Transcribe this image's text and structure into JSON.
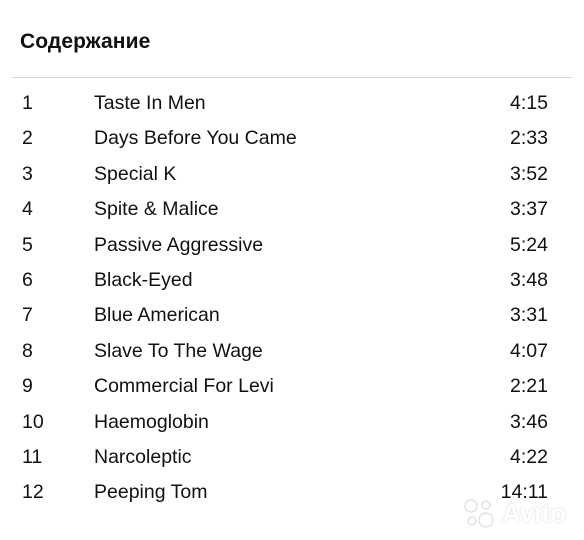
{
  "page": {
    "title": "Содержание"
  },
  "tracks": [
    {
      "number": "1",
      "title": "Taste In Men",
      "duration": "4:15"
    },
    {
      "number": "2",
      "title": "Days Before You Came",
      "duration": "2:33"
    },
    {
      "number": "3",
      "title": "Special K",
      "duration": "3:52"
    },
    {
      "number": "4",
      "title": "Spite & Malice",
      "duration": "3:37"
    },
    {
      "number": "5",
      "title": "Passive Aggressive",
      "duration": "5:24"
    },
    {
      "number": "6",
      "title": "Black-Eyed",
      "duration": "3:48"
    },
    {
      "number": "7",
      "title": "Blue American",
      "duration": "3:31"
    },
    {
      "number": "8",
      "title": "Slave To The Wage",
      "duration": "4:07"
    },
    {
      "number": "9",
      "title": "Commercial For Levi",
      "duration": "2:21"
    },
    {
      "number": "10",
      "title": "Haemoglobin",
      "duration": "3:46"
    },
    {
      "number": "11",
      "title": "Narcoleptic",
      "duration": "4:22"
    },
    {
      "number": "12",
      "title": "Peeping Tom",
      "duration": "14:11"
    }
  ],
  "watermark": {
    "text": "Avito",
    "icon": "avito-logo-icon"
  }
}
